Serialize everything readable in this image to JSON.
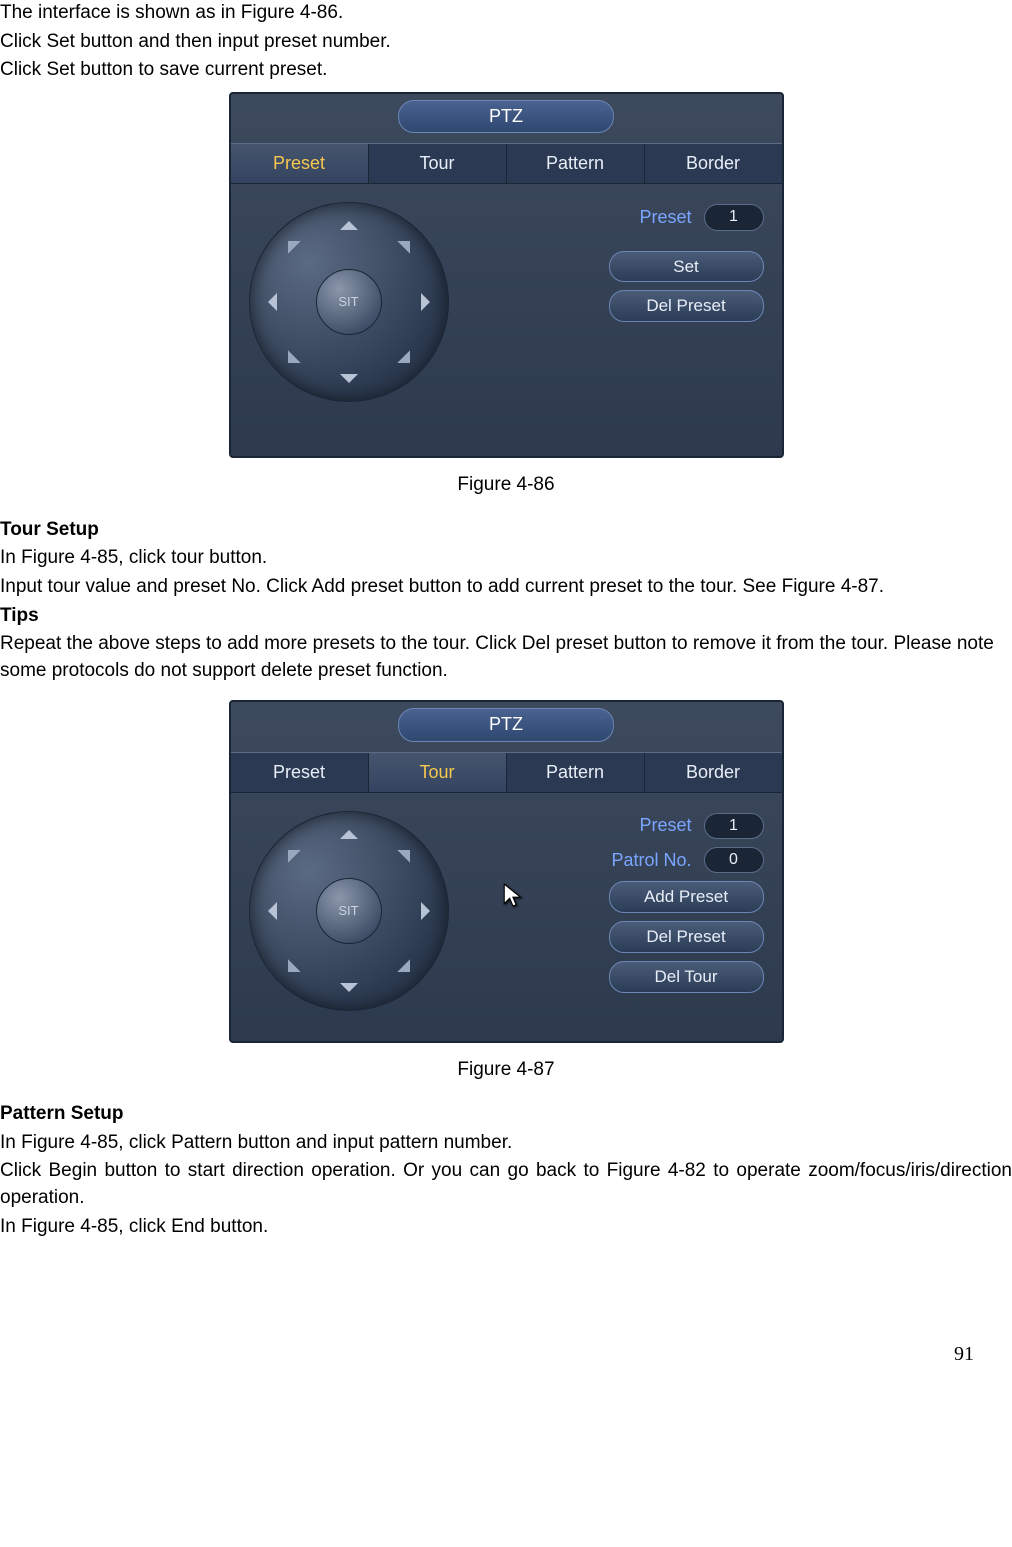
{
  "intro": {
    "l1": "The interface is shown as in Figure 4-86.",
    "l2": "Click Set button and then input preset number.",
    "l3": "Click Set button to save current preset."
  },
  "fig86": {
    "title": "PTZ",
    "tabs": {
      "preset": "Preset",
      "tour": "Tour",
      "pattern": "Pattern",
      "border": "Border"
    },
    "sit": "SIT",
    "preset_label": "Preset",
    "preset_value": "1",
    "btn_set": "Set",
    "btn_del_preset": "Del Preset",
    "caption": "Figure 4-86"
  },
  "tour_setup": {
    "h": "Tour Setup",
    "l1": "In Figure 4-85, click tour button.",
    "l2": "Input tour value and preset No. Click Add preset button to add current preset to the tour. See Figure 4-87.",
    "tips_h": "Tips",
    "l3": "Repeat the above steps to add more presets to the tour. Click Del preset button to remove it from the tour. Please note some protocols do not support delete preset function."
  },
  "fig87": {
    "title": "PTZ",
    "tabs": {
      "preset": "Preset",
      "tour": "Tour",
      "pattern": "Pattern",
      "border": "Border"
    },
    "sit": "SIT",
    "preset_label": "Preset",
    "preset_value": "1",
    "patrol_label": "Patrol No.",
    "patrol_value": "0",
    "btn_add_preset": "Add Preset",
    "btn_del_preset": "Del Preset",
    "btn_del_tour": "Del Tour",
    "caption": "Figure 4-87"
  },
  "pattern_setup": {
    "h": "Pattern Setup",
    "l1": "In Figure 4-85, click Pattern button and input pattern number.",
    "l2": "Click Begin button to start direction operation. Or you can go back to Figure 4-82 to operate zoom/focus/iris/direction operation.",
    "l3": "In Figure 4-85, click End button."
  },
  "page_number": "91"
}
